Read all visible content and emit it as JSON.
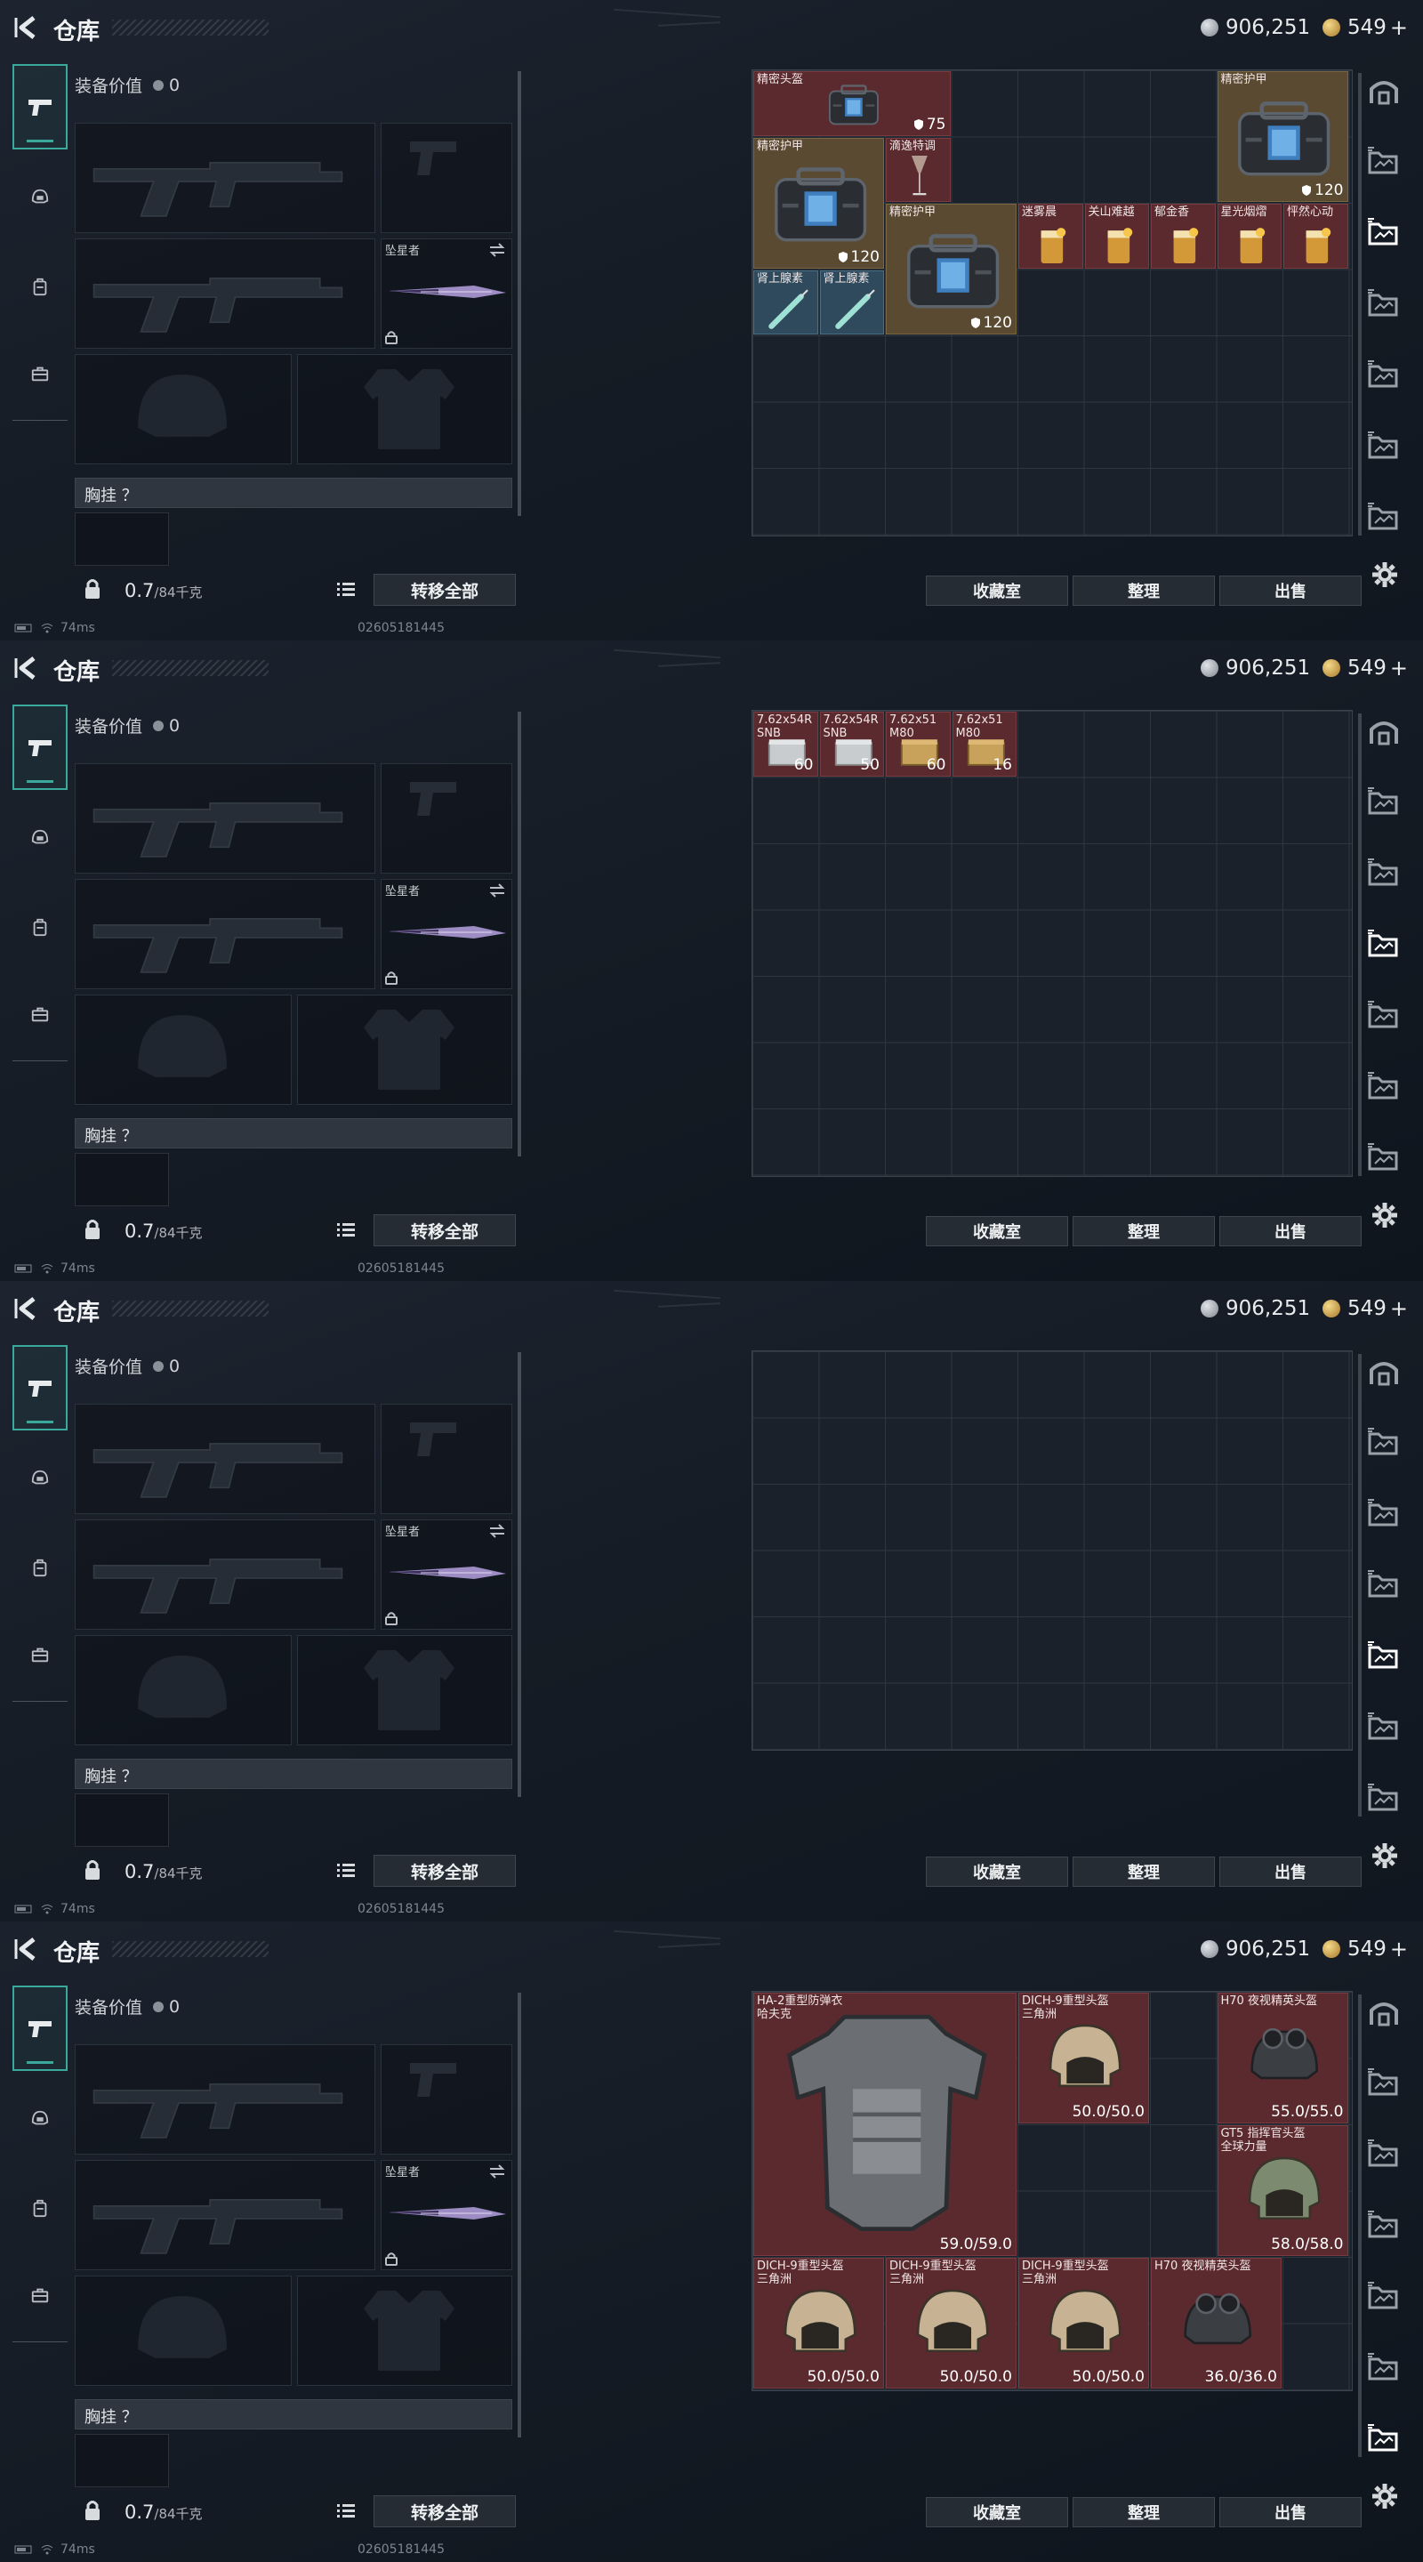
{
  "header": {
    "title": "仓库",
    "silver": "906,251",
    "gold": "549",
    "gold_plus": "+"
  },
  "loadout": {
    "value_label": "装备价值",
    "value": "0",
    "knife_label": "坠星者",
    "chest_label": "胸挂 ？",
    "weight": "0.7",
    "weight_max": "/84千克",
    "transfer_all": "转移全部"
  },
  "actions": {
    "collection": "收藏室",
    "sort": "整理",
    "sell": "出售"
  },
  "status": {
    "ping": "74ms",
    "uid": "02605181445"
  },
  "icons": {
    "left_nav": [
      "pistol-icon",
      "helmet-icon",
      "backpack-icon",
      "toolbox-icon"
    ],
    "right_nav": [
      "arch-icon",
      "storage-tab-1-icon",
      "storage-tab-2-icon",
      "storage-tab-3-icon",
      "storage-tab-4-icon",
      "storage-tab-5-icon",
      "storage-tab-6-icon"
    ],
    "settings": "gear-icon"
  },
  "colors": {
    "accent": "#3aa89a",
    "item_red": "#5b2a2e",
    "item_blue": "#2e4a5c",
    "item_khaki": "#5b4a32"
  },
  "pages": [
    {
      "active_tab": 2,
      "items": [
        {
          "name": "精密头盔",
          "value": "75",
          "shield": true
        },
        {
          "name": "精密护甲",
          "value": "120",
          "shield": true
        },
        {
          "name": "精密护甲",
          "value": "120",
          "shield": true
        },
        {
          "name": "滴逸特调",
          "value": ""
        },
        {
          "name": "精密护甲",
          "value": "120",
          "shield": true
        },
        {
          "name": "迷雾晨",
          "value": ""
        },
        {
          "name": "关山难越",
          "value": ""
        },
        {
          "name": "郁金香",
          "value": ""
        },
        {
          "name": "星光烟熠",
          "value": ""
        },
        {
          "name": "怦然心动",
          "value": ""
        },
        {
          "name": "肾上腺素",
          "value": ""
        },
        {
          "name": "肾上腺素",
          "value": ""
        }
      ]
    },
    {
      "active_tab": 3,
      "items": [
        {
          "name": "7.62x54R\nSNB",
          "value": "60"
        },
        {
          "name": "7.62x54R\nSNB",
          "value": "50"
        },
        {
          "name": "7.62x51\nM80",
          "value": "60"
        },
        {
          "name": "7.62x51\nM80",
          "value": "16"
        }
      ]
    },
    {
      "active_tab": 4,
      "items": []
    },
    {
      "active_tab": 6,
      "items": [
        {
          "name": "HA-2重型防弹衣\n哈夫克",
          "value": "59.0/59.0"
        },
        {
          "name": "DICH-9重型头盔\n三角洲",
          "value": "50.0/50.0"
        },
        {
          "name": "H70 夜视精英头盔",
          "value": "55.0/55.0"
        },
        {
          "name": "GT5 指挥官头盔\n全球力量",
          "value": "58.0/58.0"
        },
        {
          "name": "DICH-9重型头盔\n三角洲",
          "value": "50.0/50.0"
        },
        {
          "name": "DICH-9重型头盔\n三角洲",
          "value": "50.0/50.0"
        },
        {
          "name": "DICH-9重型头盔\n三角洲",
          "value": "50.0/50.0"
        },
        {
          "name": "H70 夜视精英头盔",
          "value": "36.0/36.0"
        }
      ]
    }
  ]
}
